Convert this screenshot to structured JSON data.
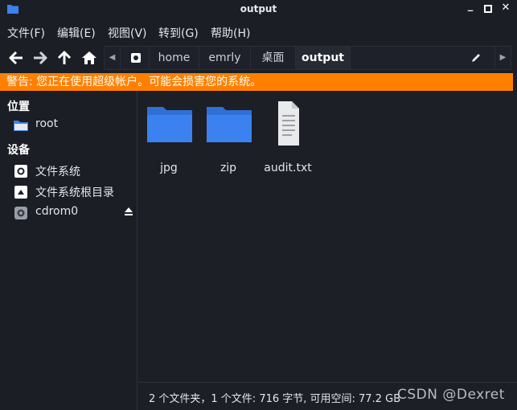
{
  "window": {
    "title": "output"
  },
  "menu": [
    "文件(F)",
    "编辑(E)",
    "视图(V)",
    "转到(G)",
    "帮助(H)"
  ],
  "path": {
    "crumbs": [
      "home",
      "emrly",
      "桌面",
      "output"
    ],
    "active": "output"
  },
  "warning": "警告: 您正在使用超级帐户。可能会损害您的系统。",
  "sidebar": {
    "places_heading": "位置",
    "places": [
      {
        "label": "root",
        "icon": "home-folder-icon"
      }
    ],
    "devices_heading": "设备",
    "devices": [
      {
        "label": "文件系统",
        "icon": "drive-icon"
      },
      {
        "label": "文件系统根目录",
        "icon": "drive-root-icon"
      },
      {
        "label": "cdrom0",
        "icon": "disc-icon",
        "ejectable": true
      }
    ]
  },
  "files": [
    {
      "name": "jpg",
      "type": "folder"
    },
    {
      "name": "zip",
      "type": "folder"
    },
    {
      "name": "audit.txt",
      "type": "text-file"
    }
  ],
  "status": "2 个文件夹，1 个文件: 716 字节, 可用空间: 77.2 GB",
  "watermark": "CSDN @Dexret",
  "colors": {
    "accent_folder": "#3b82f0",
    "warning_bg": "#ff8000",
    "bg": "#1c1f26"
  }
}
